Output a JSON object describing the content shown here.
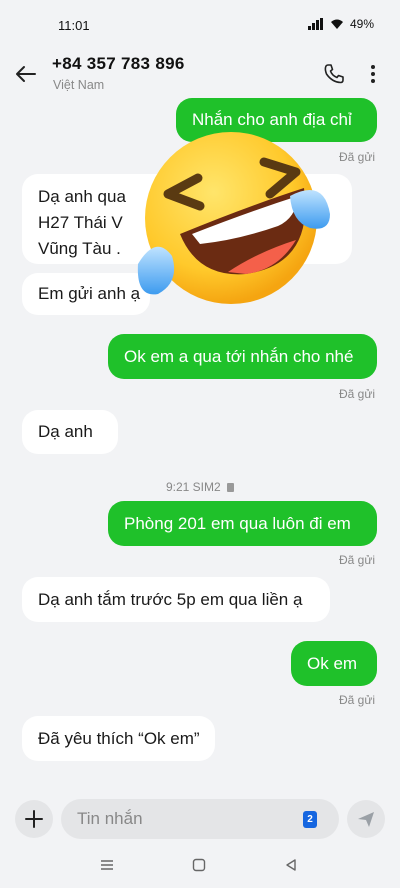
{
  "status": {
    "time": "11:01",
    "battery": "49%"
  },
  "contact": {
    "name": "+84 357 783 896",
    "country": "Việt Nam"
  },
  "messages": [
    {
      "dir": "sent",
      "text": "Nhắn cho anh địa chỉ",
      "status": "Đã gửi"
    },
    {
      "dir": "recv",
      "lines": [
        "Dạ anh qua",
        "H27 Thái V",
        "Vũng Tàu ."
      ]
    },
    {
      "dir": "recv",
      "text": "Em gửi anh ạ"
    },
    {
      "dir": "sent",
      "text": "Ok em a qua tới nhắn cho nhé",
      "status": "Đã gửi"
    },
    {
      "dir": "recv",
      "text": "Dạ anh"
    },
    {
      "dir": "sent",
      "text": "Phòng 201 em qua luôn đi em",
      "status": "Đã gửi"
    },
    {
      "dir": "recv",
      "text": "Dạ anh tắm trước 5p em qua liền ạ"
    },
    {
      "dir": "sent",
      "text": "Ok em",
      "status": "Đã gửi"
    },
    {
      "dir": "recv",
      "text": "Đã yêu thích “Ok em”"
    }
  ],
  "time_separator": "9:21 SIM2",
  "input": {
    "placeholder": "Tin nhắn",
    "sim": "2"
  },
  "icons": {
    "back": "arrow-left-icon",
    "call": "phone-icon",
    "more": "more-vertical-icon",
    "emoji": "laughing-crying-emoji",
    "add": "plus-icon",
    "send": "send-icon",
    "nav": [
      "menu-icon",
      "home-icon",
      "back-triangle-icon"
    ]
  },
  "colors": {
    "sent_bubble": "#1fc12a",
    "received_bubble": "#ffffff",
    "background": "#f2f3f5",
    "sim_badge": "#1566e0"
  }
}
